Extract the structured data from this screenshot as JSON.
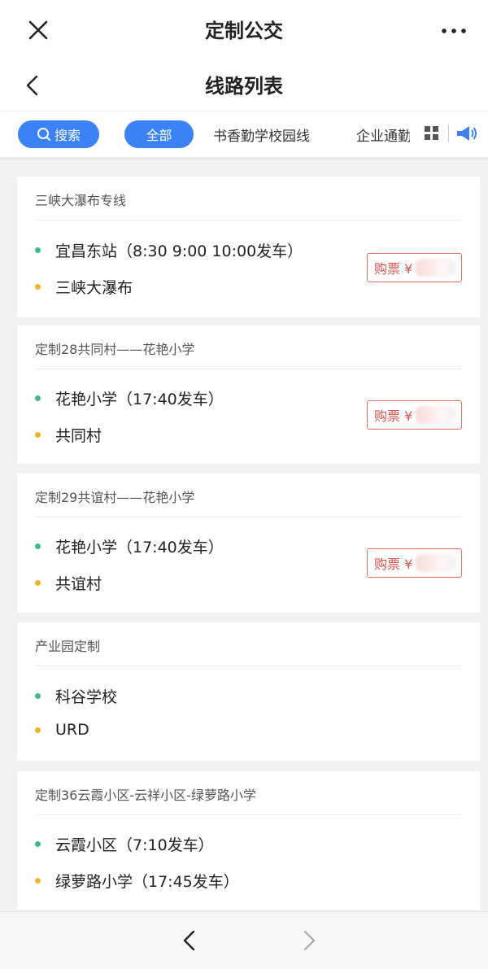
{
  "topbar": {
    "title": "定制公交"
  },
  "navbar": {
    "title": "线路列表"
  },
  "tabs": {
    "search_label": "搜索",
    "all_label": "全部",
    "items": [
      "书香勤学校园线",
      "企业通勤"
    ]
  },
  "routes": [
    {
      "name": "三峡大瀑布专线",
      "start": "宜昌东站（8:30 9:00 10:00发车）",
      "end": "三峡大瀑布",
      "buy_label": "购票 ¥"
    },
    {
      "name": "定制28共同村——花艳小学",
      "start": "花艳小学（17:40发车）",
      "end": "共同村",
      "buy_label": "购票 ¥"
    },
    {
      "name": "定制29共谊村——花艳小学",
      "start": "花艳小学（17:40发车）",
      "end": "共谊村",
      "buy_label": "购票 ¥"
    },
    {
      "name": "产业园定制",
      "start": "科谷学校",
      "end": "URD"
    },
    {
      "name": "定制36云霞小区-云祥小区-绿萝路小学",
      "start": "云霞小区（7:10发车）",
      "end": "绿萝路小学（17:45发车）"
    }
  ],
  "colors": {
    "accent": "#3b82f6",
    "start_dot": "#3cba8a",
    "end_dot": "#f0b429",
    "buy_border": "#e07060"
  }
}
